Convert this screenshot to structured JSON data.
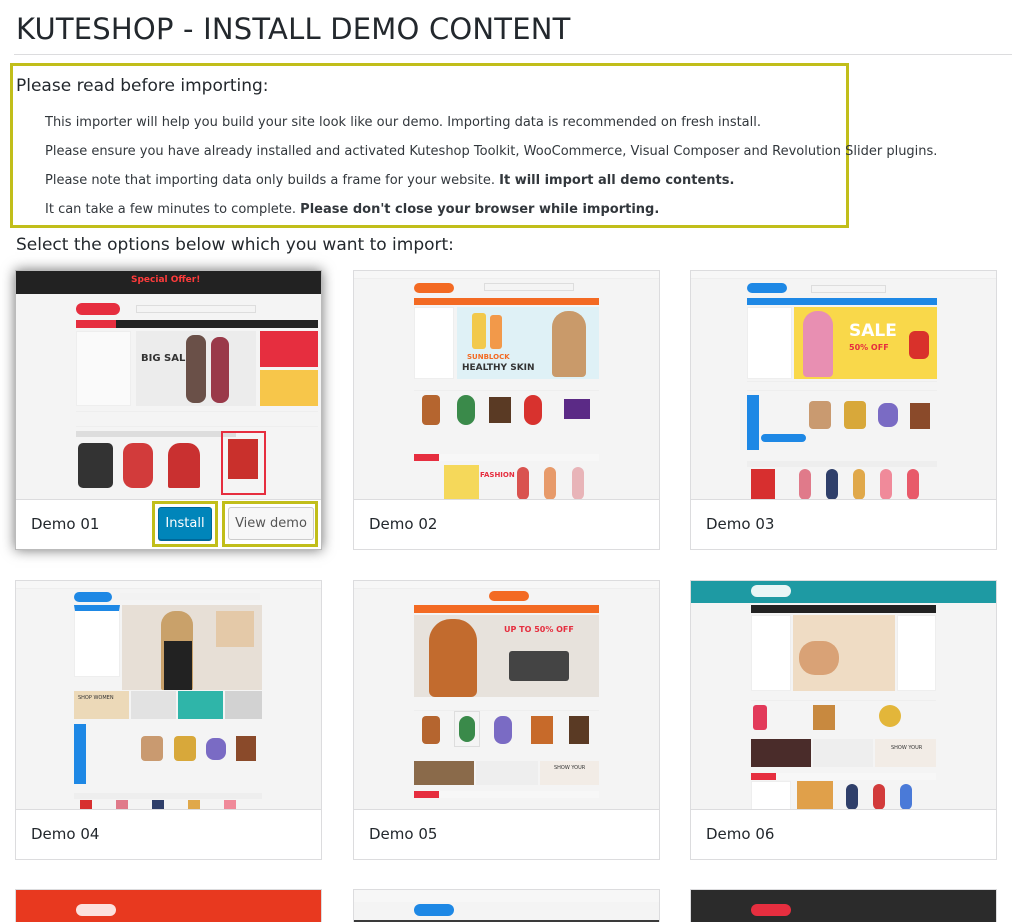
{
  "page": {
    "title": "KUTESHOP - INSTALL DEMO CONTENT"
  },
  "notice": {
    "heading": "Please read before importing:",
    "line1": "This importer will help you build your site look like our demo. Importing data is recommended on fresh install.",
    "line2": "Please ensure you have already installed and activated Kuteshop Toolkit, WooCommerce, Visual Composer and Revolution Slider plugins.",
    "line3_plain": "Please note that importing data only builds a frame for your website. ",
    "line3_bold": "It will import all demo contents.",
    "line4_plain": "It can take a few minutes to complete. ",
    "line4_bold": "Please don't close your browser while importing."
  },
  "select_heading": "Select the options below which you want to import:",
  "buttons": {
    "install": "Install",
    "view_demo": "View demo"
  },
  "demos": [
    {
      "name": "Demo 01",
      "banner": "BIG SALE",
      "promo": "Special Offer!"
    },
    {
      "name": "Demo 02",
      "banner": "HEALTHY SKIN",
      "tag": "SUNBLOCK",
      "section": "FASHION"
    },
    {
      "name": "Demo 03",
      "banner": "SALE",
      "sub": "50% OFF"
    },
    {
      "name": "Demo 04",
      "sub": "SHOP WOMEN"
    },
    {
      "name": "Demo 05",
      "banner": "UP TO 50% OFF",
      "sub": "SHOW YOUR"
    },
    {
      "name": "Demo 06",
      "sub": "SHOW YOUR"
    }
  ],
  "colors": {
    "highlight": "#c1be1a",
    "primary_button": "#0085ba",
    "shop_orange": "#f36a23",
    "shop_red": "#e62e3f",
    "shop_teal": "#1e9aa3",
    "shop_blue": "#1e88e5"
  },
  "icons": [
    "cart-logo-icon"
  ]
}
